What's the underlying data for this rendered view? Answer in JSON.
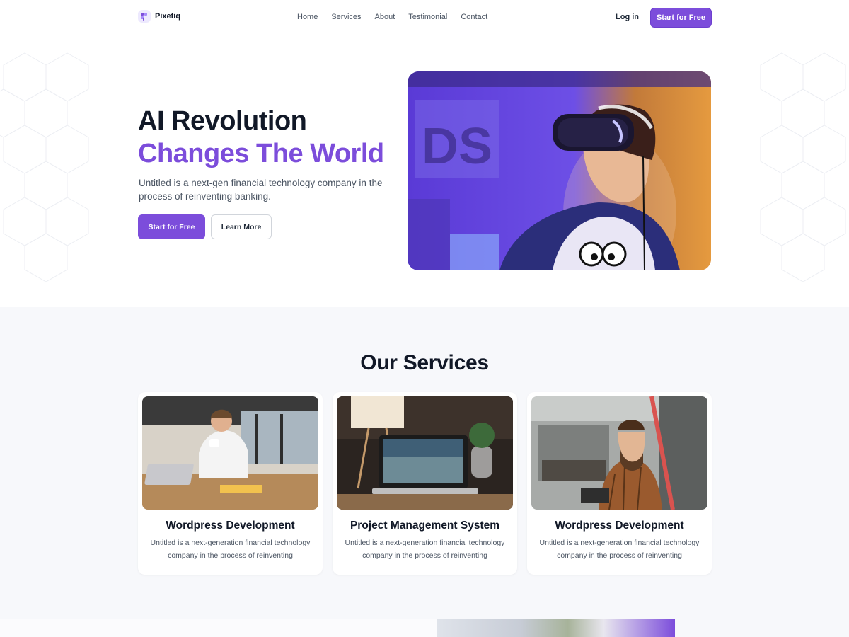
{
  "brand": {
    "name": "Pixetiq",
    "accent_color": "#7c4ddb"
  },
  "nav": {
    "items": [
      {
        "label": "Home"
      },
      {
        "label": "Services"
      },
      {
        "label": "About"
      },
      {
        "label": "Testimonial"
      },
      {
        "label": "Contact"
      }
    ],
    "login_label": "Log in",
    "cta_label": "Start for Free"
  },
  "hero": {
    "title_line1": "AI Revolution",
    "title_line2": "Changes The World",
    "description": "Untitled is a next-gen financial technology company in the process of reinventing banking.",
    "primary_button": "Start for Free",
    "secondary_button": "Learn More",
    "image_icon": "vr-headset-photo"
  },
  "services": {
    "heading": "Our Services",
    "cards": [
      {
        "title": "Wordpress Development",
        "description": "Untitled is a next-generation financial technology company in the process of reinventing",
        "image_icon": "office-coffee-photo"
      },
      {
        "title": "Project Management System",
        "description": "Untitled is a next-generation financial technology company in the process of reinventing",
        "image_icon": "laptop-desk-photo"
      },
      {
        "title": "Wordpress Development",
        "description": "Untitled is a next-generation financial technology company in the process of reinventing",
        "image_icon": "man-workshop-photo"
      }
    ]
  }
}
